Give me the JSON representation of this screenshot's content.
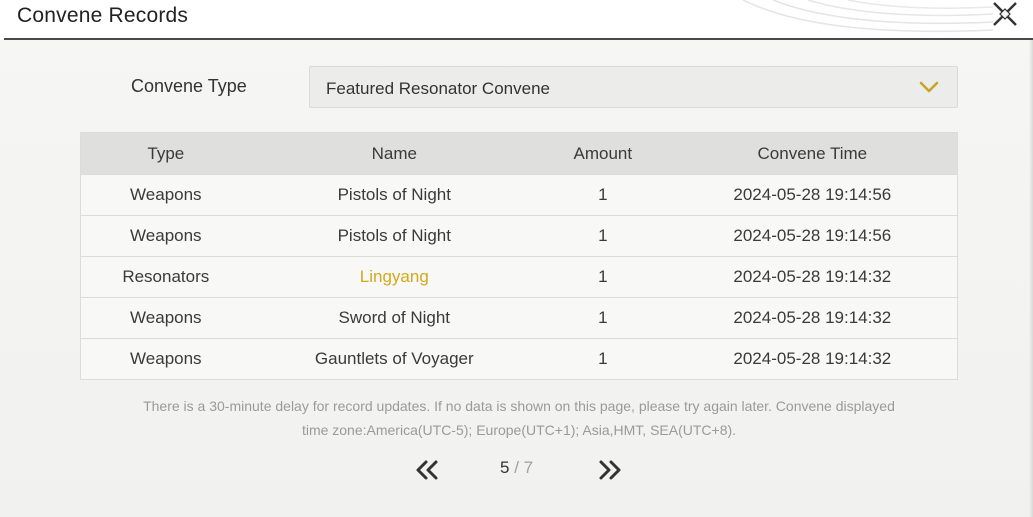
{
  "window": {
    "title": "Convene Records"
  },
  "filter": {
    "label": "Convene Type",
    "selected": "Featured Resonator Convene"
  },
  "table": {
    "headers": [
      "Type",
      "Name",
      "Amount",
      "Convene Time"
    ],
    "rows": [
      {
        "type": "Weapons",
        "name": "Pistols of Night",
        "amount": "1",
        "time": "2024-05-28 19:14:56",
        "highlight": false
      },
      {
        "type": "Weapons",
        "name": "Pistols of Night",
        "amount": "1",
        "time": "2024-05-28 19:14:56",
        "highlight": false
      },
      {
        "type": "Resonators",
        "name": "Lingyang",
        "amount": "1",
        "time": "2024-05-28 19:14:32",
        "highlight": true
      },
      {
        "type": "Weapons",
        "name": "Sword of Night",
        "amount": "1",
        "time": "2024-05-28 19:14:32",
        "highlight": false
      },
      {
        "type": "Weapons",
        "name": "Gauntlets of Voyager",
        "amount": "1",
        "time": "2024-05-28 19:14:32",
        "highlight": false
      }
    ]
  },
  "notice": {
    "line1": "There is a 30-minute delay for record updates. If no data is shown on this page, please try again later. Convene displayed",
    "line2": "time zone:America(UTC-5); Europe(UTC+1); Asia,HMT, SEA(UTC+8)."
  },
  "pagination": {
    "current": "5",
    "separator": " / ",
    "total": "7"
  },
  "icons": {
    "close": "close-icon",
    "dropdown": "chevron-down-icon",
    "prev": "double-chevron-left-icon",
    "next": "double-chevron-right-icon"
  },
  "colors": {
    "accent_gold": "#d4a81c",
    "text": "#3a3a3a",
    "muted": "#9a9a98"
  }
}
